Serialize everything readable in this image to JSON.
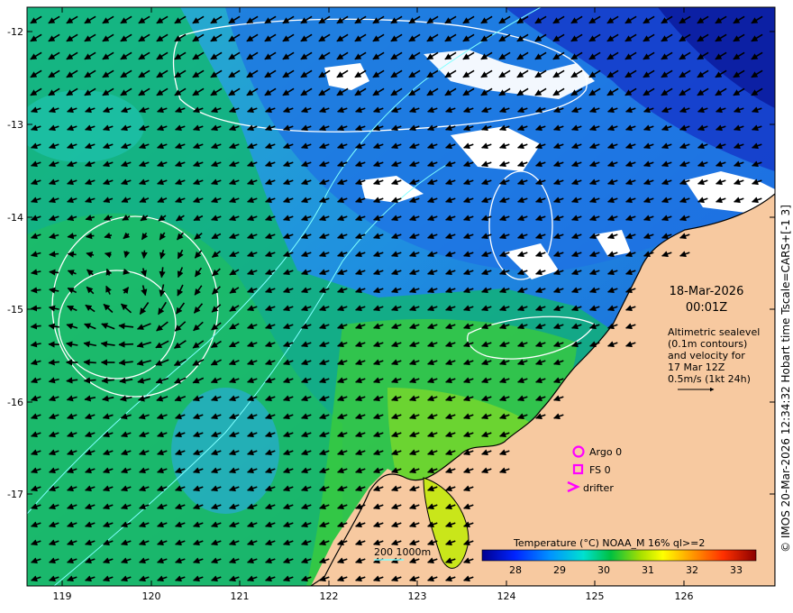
{
  "map": {
    "longitude_ticks": [
      "119",
      "120",
      "121",
      "122",
      "123",
      "124",
      "125",
      "126"
    ],
    "latitude_ticks": [
      "-12",
      "-13",
      "-14",
      "-15",
      "-16",
      "-17"
    ],
    "date_label": "18-Mar-2026",
    "time_label": "00:01Z",
    "info_lines": [
      "Altimetric sealevel",
      "(0.1m contours)",
      "and velocity for",
      "17 Mar 12Z",
      "0.5m/s (1kt 24h)"
    ],
    "legend_items": [
      {
        "label": "Argo 0",
        "color": "#ff00ff",
        "symbol": "circle-icon"
      },
      {
        "label": "FS 0",
        "color": "#ff00ff",
        "symbol": "square-icon"
      },
      {
        "label": "drifter",
        "color": "#ff00ff",
        "symbol": "chevron-icon"
      }
    ],
    "isobath_label": "200  1000m",
    "colorbar_title": "Temperature (°C) NOAA_M 16% ql>=2",
    "colorbar_ticks": [
      "28",
      "29",
      "30",
      "31",
      "32",
      "33"
    ],
    "side_text": "© IMOS 20-Mar-2026 12:34:32 Hobart time Tscale=CARS+[-1 3]",
    "colors": {
      "land": "#f7c9a0",
      "coast": "#000000",
      "contour": "#ffffff",
      "isobath": "#7fffff",
      "marker": "#ff00ff"
    }
  }
}
